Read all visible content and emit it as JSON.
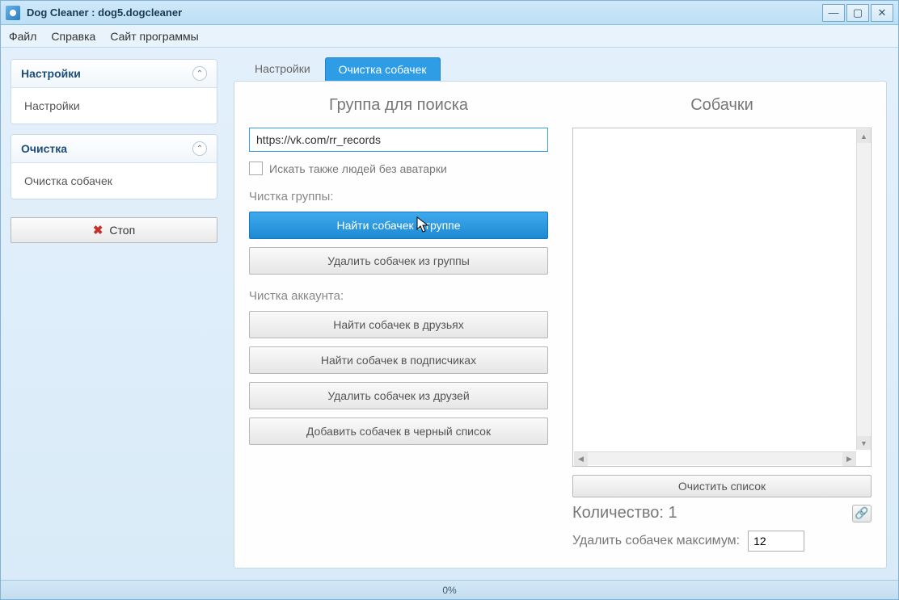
{
  "window": {
    "title": "Dog Cleaner :   dog5.dogcleaner"
  },
  "menu": {
    "file": "Файл",
    "help": "Справка",
    "site": "Сайт программы"
  },
  "sidebar": {
    "panel1_title": "Настройки",
    "panel1_item": "Настройки",
    "panel2_title": "Очистка",
    "panel2_item": "Очистка собачек",
    "stop_label": "Стоп"
  },
  "tabs": {
    "settings": "Настройки",
    "clean": "Очистка собачек"
  },
  "left": {
    "heading": "Группа для поиска",
    "url_value": "https://vk.com/rr_records",
    "chk_label": "Искать также людей без аватарки",
    "group_label": "Чистка группы:",
    "btn_find_group": "Найти собачек в группе",
    "btn_del_group": "Удалить собачек из группы",
    "acct_label": "Чистка аккаунта:",
    "btn_find_friends": "Найти собачек в друзьях",
    "btn_find_subs": "Найти собачек в подписчиках",
    "btn_del_friends": "Удалить собачек из друзей",
    "btn_blacklist": "Добавить собачек в черный список"
  },
  "right": {
    "heading": "Собачки",
    "clear_list": "Очистить список",
    "count_label": "Количество: 1",
    "max_label": "Удалить собачек максимум:",
    "max_value": "12"
  },
  "status": {
    "progress": "0%"
  }
}
